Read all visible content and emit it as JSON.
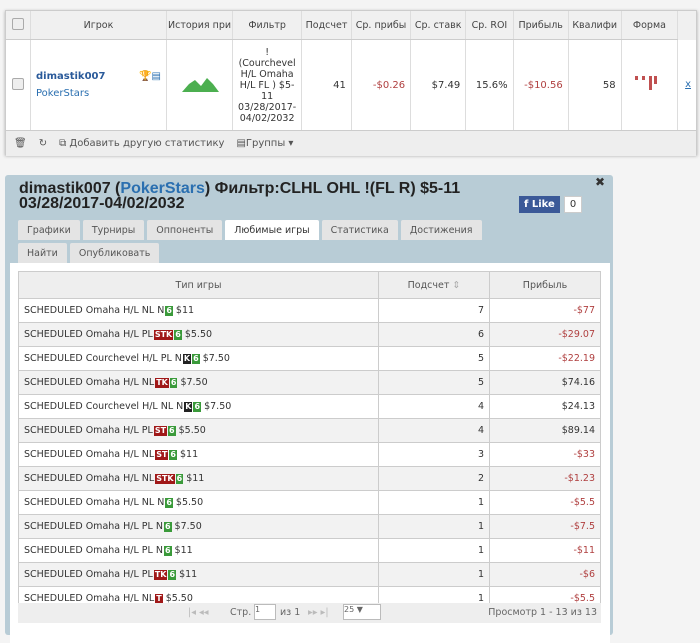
{
  "top": {
    "headers": [
      "Игрок",
      "История при",
      "Фильтр",
      "Подсчет",
      "Ср. прибы",
      "Ср. ставк",
      "Ср. ROI",
      "Прибыль",
      "Квалифи",
      "Форма"
    ],
    "row": {
      "player": "dimastik007",
      "site": "PokerStars",
      "filter": "! (Courchevel H/L Omaha H/L FL ) $5-11 03/28/2017-04/02/2032",
      "count": "41",
      "avg_profit": "-$0.26",
      "avg_stake": "$7.49",
      "roi": "15.6%",
      "profit": "-$10.56",
      "qual": "58",
      "remove": "x"
    },
    "footer": {
      "add": "Добавить другую статистику",
      "groups": "Группы"
    }
  },
  "window": {
    "title_player": "dimastik007",
    "title_site": "PokerStars",
    "title_rest": "Фильтр:CLHL OHL !(FL R) $5-11 03/28/2017-04/02/2032",
    "like": "Like",
    "like_count": "0",
    "tabs": [
      "Графики",
      "Турниры",
      "Оппоненты",
      "Любимые игры",
      "Статистика",
      "Достижения",
      "Найти",
      "Опубликовать"
    ],
    "active_tab": "Любимые игры"
  },
  "grid": {
    "headers": [
      "Тип игры",
      "Подсчет",
      "Прибыль"
    ],
    "rows": [
      {
        "name": "SCHEDULED Omaha H/L NL N",
        "badges": [
          [
            "6",
            "#3a9a3a"
          ]
        ],
        "buyin": "$11",
        "count": "7",
        "profit": "-$77"
      },
      {
        "name": "SCHEDULED Omaha H/L PL",
        "badges": [
          [
            "STK",
            "#a01818"
          ],
          [
            "6",
            "#3a9a3a"
          ]
        ],
        "buyin": "$5.50",
        "count": "6",
        "profit": "-$29.07"
      },
      {
        "name": "SCHEDULED Courchevel H/L PL N",
        "badges": [
          [
            "K",
            "#222"
          ],
          [
            "6",
            "#3a9a3a"
          ]
        ],
        "buyin": "$7.50",
        "count": "5",
        "profit": "-$22.19"
      },
      {
        "name": "SCHEDULED Omaha H/L NL",
        "badges": [
          [
            "TK",
            "#a01818"
          ],
          [
            "6",
            "#3a9a3a"
          ]
        ],
        "buyin": "$7.50",
        "count": "5",
        "profit": "$74.16"
      },
      {
        "name": "SCHEDULED Courchevel H/L NL N",
        "badges": [
          [
            "K",
            "#222"
          ],
          [
            "6",
            "#3a9a3a"
          ]
        ],
        "buyin": "$7.50",
        "count": "4",
        "profit": "$24.13"
      },
      {
        "name": "SCHEDULED Omaha H/L PL",
        "badges": [
          [
            "ST",
            "#a01818"
          ],
          [
            "6",
            "#3a9a3a"
          ]
        ],
        "buyin": "$5.50",
        "count": "4",
        "profit": "$89.14"
      },
      {
        "name": "SCHEDULED Omaha H/L NL",
        "badges": [
          [
            "ST",
            "#a01818"
          ],
          [
            "6",
            "#3a9a3a"
          ]
        ],
        "buyin": "$11",
        "count": "3",
        "profit": "-$33"
      },
      {
        "name": "SCHEDULED Omaha H/L NL",
        "badges": [
          [
            "STK",
            "#a01818"
          ],
          [
            "6",
            "#3a9a3a"
          ]
        ],
        "buyin": "$11",
        "count": "2",
        "profit": "-$1.23"
      },
      {
        "name": "SCHEDULED Omaha H/L NL N",
        "badges": [
          [
            "6",
            "#3a9a3a"
          ]
        ],
        "buyin": "$5.50",
        "count": "1",
        "profit": "-$5.5"
      },
      {
        "name": "SCHEDULED Omaha H/L PL N",
        "badges": [
          [
            "6",
            "#3a9a3a"
          ]
        ],
        "buyin": "$7.50",
        "count": "1",
        "profit": "-$7.5"
      },
      {
        "name": "SCHEDULED Omaha H/L PL N",
        "badges": [
          [
            "6",
            "#3a9a3a"
          ]
        ],
        "buyin": "$11",
        "count": "1",
        "profit": "-$11"
      },
      {
        "name": "SCHEDULED Omaha H/L PL",
        "badges": [
          [
            "TK",
            "#a01818"
          ],
          [
            "6",
            "#3a9a3a"
          ]
        ],
        "buyin": "$11",
        "count": "1",
        "profit": "-$6"
      },
      {
        "name": "SCHEDULED Omaha H/L NL",
        "badges": [
          [
            "T",
            "#a01818"
          ]
        ],
        "buyin": "$5.50",
        "count": "1",
        "profit": "-$5.5"
      }
    ],
    "pager": {
      "page_label": "Стр.",
      "page": "1",
      "of": "из 1",
      "per_page": "25",
      "summary": "Просмотр 1 - 13 из 13"
    }
  }
}
